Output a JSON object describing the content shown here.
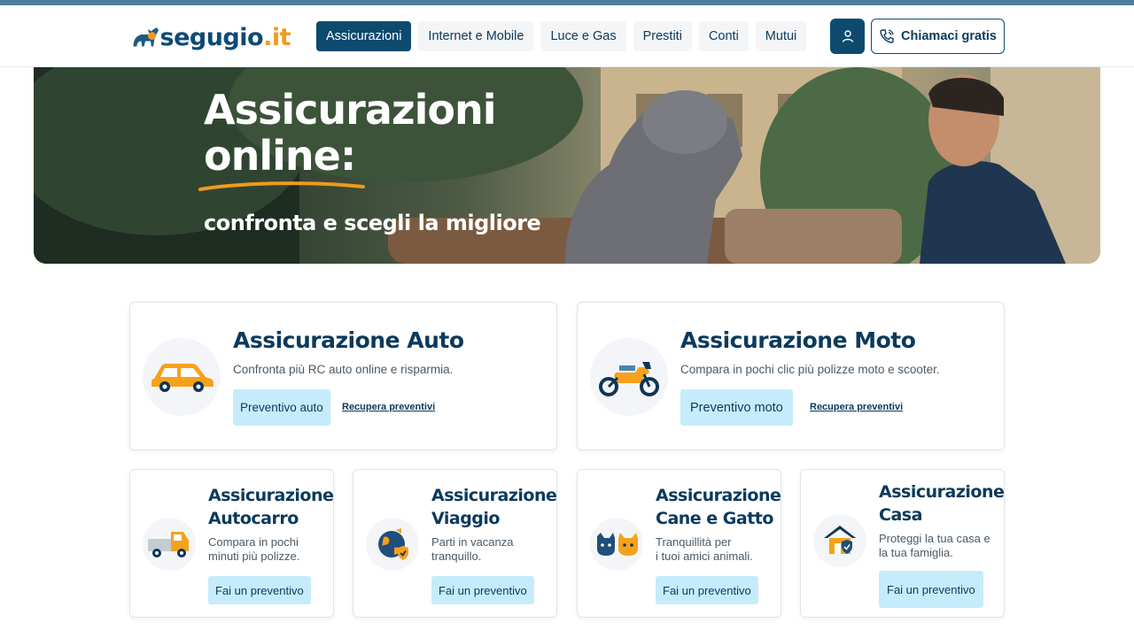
{
  "brand": {
    "name": "segugio",
    "tld": ".it"
  },
  "nav": {
    "items": [
      {
        "label": "Assicurazioni",
        "active": true
      },
      {
        "label": "Internet e Mobile",
        "active": false
      },
      {
        "label": "Luce e Gas",
        "active": false
      },
      {
        "label": "Prestiti",
        "active": false
      },
      {
        "label": "Conti",
        "active": false
      },
      {
        "label": "Mutui",
        "active": false
      }
    ],
    "call_label": "Chiamaci gratis"
  },
  "hero": {
    "title_line1": "Assicurazioni",
    "title_line2": "online:",
    "subtitle": "confronta e scegli la migliore"
  },
  "cards_large": [
    {
      "title": "Assicurazione Auto",
      "description": "Confronta più RC auto online e risparmia.",
      "button": "Preventivo auto",
      "link": "Recupera preventivi",
      "icon": "car-icon"
    },
    {
      "title": "Assicurazione Moto",
      "description": "Compara in pochi clic più polizze moto e scooter.",
      "button": "Preventivo moto",
      "link": "Recupera preventivi",
      "icon": "motorcycle-icon"
    }
  ],
  "cards_small": [
    {
      "title_line1": "Assicurazione",
      "title_line2": "Autocarro",
      "description_line1": "Compara in pochi",
      "description_line2": "minuti più polizze.",
      "button": "Fai un preventivo",
      "icon": "truck-icon"
    },
    {
      "title_line1": "Assicurazione",
      "title_line2": "Viaggio",
      "description_line1": "Parti in vacanza",
      "description_line2": "tranquillo.",
      "button": "Fai un preventivo",
      "icon": "globe-icon"
    },
    {
      "title_line1": "Assicurazione",
      "title_line2": "Cane e Gatto",
      "description_line1": "Tranquillità per",
      "description_line2": "i tuoi amici animali.",
      "button": "Fai un preventivo",
      "icon": "pets-icon"
    },
    {
      "title_line1": "Assicurazione",
      "title_line2": "Casa",
      "description_line1": "Proteggi la tua casa e",
      "description_line2": "la tua famiglia.",
      "button": "Fai un preventivo",
      "icon": "house-icon"
    }
  ],
  "colors": {
    "brand_blue": "#0e4a6e",
    "brand_orange": "#f29a1a",
    "button_light": "#c6ecfb",
    "text_dark": "#0b3a5c"
  }
}
